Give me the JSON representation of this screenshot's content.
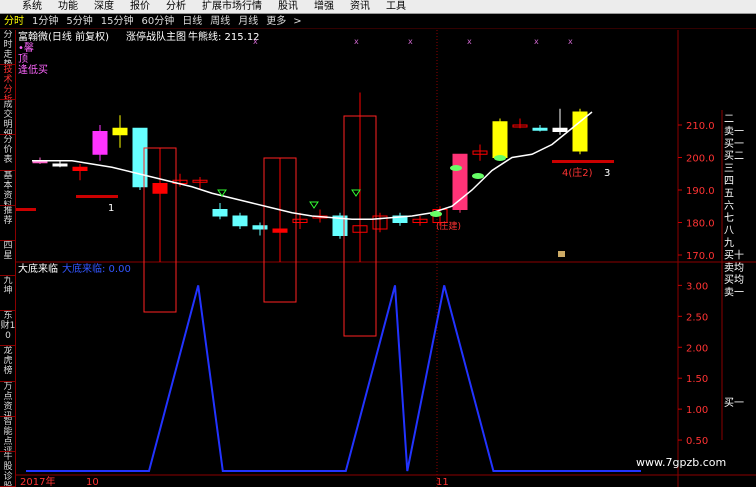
{
  "menu": {
    "items": [
      "系统",
      "功能",
      "深度",
      "报价",
      "分析",
      "扩展市场行情",
      "股讯",
      "增强",
      "资讯",
      "工具"
    ]
  },
  "periods": {
    "items": [
      "分时",
      "1分钟",
      "5分钟",
      "15分钟",
      "60分钟",
      "日线",
      "周线",
      "月线",
      "更多"
    ],
    "active_index": 0,
    "more_arrow": ">"
  },
  "sidebar": {
    "tabs": [
      "分时走势",
      "技术分析",
      "成交明细",
      "分价表",
      "基本资料",
      "推荐",
      "四星",
      "九坤",
      "东财10",
      "龙虎榜",
      "万点资讯",
      "智能点评",
      "牛股诊股"
    ],
    "active_index": 1
  },
  "main_info": {
    "stock_title": "富翰微(日线 前复权)",
    "indicator": "涨停战队主图",
    "bull_line_label": "牛熊线: 215.12",
    "legend_1": "•馨",
    "legend_2": "顶",
    "legend_3": "逢低买"
  },
  "sub_info": {
    "title": "大底来临",
    "value_label": "大底来临: 0.00"
  },
  "annotations": {
    "label_1": "1",
    "label_4": "4(庄2)",
    "label_3": "3",
    "label_zhuang": "(庄建)"
  },
  "price_axis": {
    "labels": [
      "210.0",
      "200.0",
      "190.0",
      "180.0",
      "170.0"
    ]
  },
  "sub_axis": {
    "labels": [
      "3.00",
      "2.50",
      "2.00",
      "1.50",
      "1.00",
      "0.50"
    ]
  },
  "time_axis": {
    "labels": [
      "2017年",
      "10",
      "11"
    ]
  },
  "order_book": {
    "sell": [
      "二",
      "卖一"
    ],
    "buy": [
      "买一",
      "买二",
      "三",
      "四",
      "五",
      "六",
      "七",
      "八",
      "九",
      "买十"
    ],
    "extra": [
      "卖均",
      "买均",
      "卖一"
    ],
    "bottom": "买一"
  },
  "watermark": "www.7gpzb.com",
  "chart_data": [
    {
      "type": "candlestick",
      "title": "",
      "ylim": [
        165,
        220
      ],
      "candles": [
        {
          "o": 199,
          "c": 199,
          "h": 200,
          "l": 198,
          "color": "#ff66cc"
        },
        {
          "o": 198,
          "c": 198,
          "h": 199,
          "l": 197,
          "color": "#ffffff"
        },
        {
          "o": 197,
          "c": 196,
          "h": 198,
          "l": 193,
          "color": "#ff0000"
        },
        {
          "o": 201,
          "c": 208,
          "h": 210,
          "l": 199,
          "color": "#ff33ff"
        },
        {
          "o": 207,
          "c": 209,
          "h": 213,
          "l": 203,
          "color": "#ffff00"
        },
        {
          "o": 209,
          "c": 191,
          "h": 209,
          "l": 190,
          "color": "#66ffff"
        },
        {
          "o": 192,
          "c": 189,
          "h": 203,
          "l": 120,
          "color": "#ff0000"
        },
        {
          "o": 192,
          "c": 193,
          "h": 195,
          "l": 191,
          "color": "#ff0000"
        },
        {
          "o": 193,
          "c": 193,
          "h": 194,
          "l": 190,
          "color": "#ff0000"
        },
        {
          "o": 184,
          "c": 182,
          "h": 186,
          "l": 181,
          "color": "#66ffff"
        },
        {
          "o": 182,
          "c": 179,
          "h": 183,
          "l": 178,
          "color": "#66ffff"
        },
        {
          "o": 179,
          "c": 178,
          "h": 180,
          "l": 176,
          "color": "#66ffff"
        },
        {
          "o": 178,
          "c": 177,
          "h": 200,
          "l": 130,
          "color": "#ff0000"
        },
        {
          "o": 180,
          "c": 181,
          "h": 183,
          "l": 178,
          "color": "#ff0000"
        },
        {
          "o": 182,
          "c": 182,
          "h": 184,
          "l": 180,
          "color": "#ff0000"
        },
        {
          "o": 182,
          "c": 176,
          "h": 183,
          "l": 175,
          "color": "#66ffff"
        },
        {
          "o": 177,
          "c": 179,
          "h": 220,
          "l": 110,
          "color": "#ff0000"
        },
        {
          "o": 178,
          "c": 182,
          "h": 183,
          "l": 177,
          "color": "#ff0000"
        },
        {
          "o": 182,
          "c": 180,
          "h": 183,
          "l": 179,
          "color": "#66ffff"
        },
        {
          "o": 180,
          "c": 181,
          "h": 182,
          "l": 179,
          "color": "#ff0000"
        },
        {
          "o": 180,
          "c": 184,
          "h": 185,
          "l": 179,
          "color": "#ff0000"
        },
        {
          "o": 201,
          "c": 184,
          "h": 201,
          "l": 183,
          "color": "#ff3377"
        },
        {
          "o": 201,
          "c": 202,
          "h": 204,
          "l": 199,
          "color": "#ff0000"
        },
        {
          "o": 200,
          "c": 211,
          "h": 212,
          "l": 199,
          "color": "#ffff00"
        },
        {
          "o": 210,
          "c": 210,
          "h": 212,
          "l": 209,
          "color": "#ff0000"
        },
        {
          "o": 209,
          "c": 209,
          "h": 210,
          "l": 208,
          "color": "#66ffff"
        },
        {
          "o": 209,
          "c": 208,
          "h": 215,
          "l": 207,
          "color": "#ffffff"
        },
        {
          "o": 202,
          "c": 214,
          "h": 215,
          "l": 201,
          "color": "#ffff00"
        }
      ],
      "bull_line": [
        199,
        199,
        199,
        198,
        197,
        195.5,
        194,
        192.5,
        191,
        189,
        187.5,
        186,
        184.5,
        183,
        182,
        181.5,
        181,
        181,
        181.5,
        182,
        183,
        185,
        190,
        196,
        200,
        201,
        204,
        209,
        214
      ]
    },
    {
      "type": "line",
      "title": "大底来临",
      "ylim": [
        0,
        3.2
      ],
      "x": [
        0,
        10,
        14,
        16,
        26,
        30,
        31,
        34,
        38,
        50
      ],
      "values": [
        0,
        0,
        3,
        0,
        0,
        3,
        0,
        3,
        0,
        0
      ],
      "series_name": "大底来临"
    }
  ]
}
